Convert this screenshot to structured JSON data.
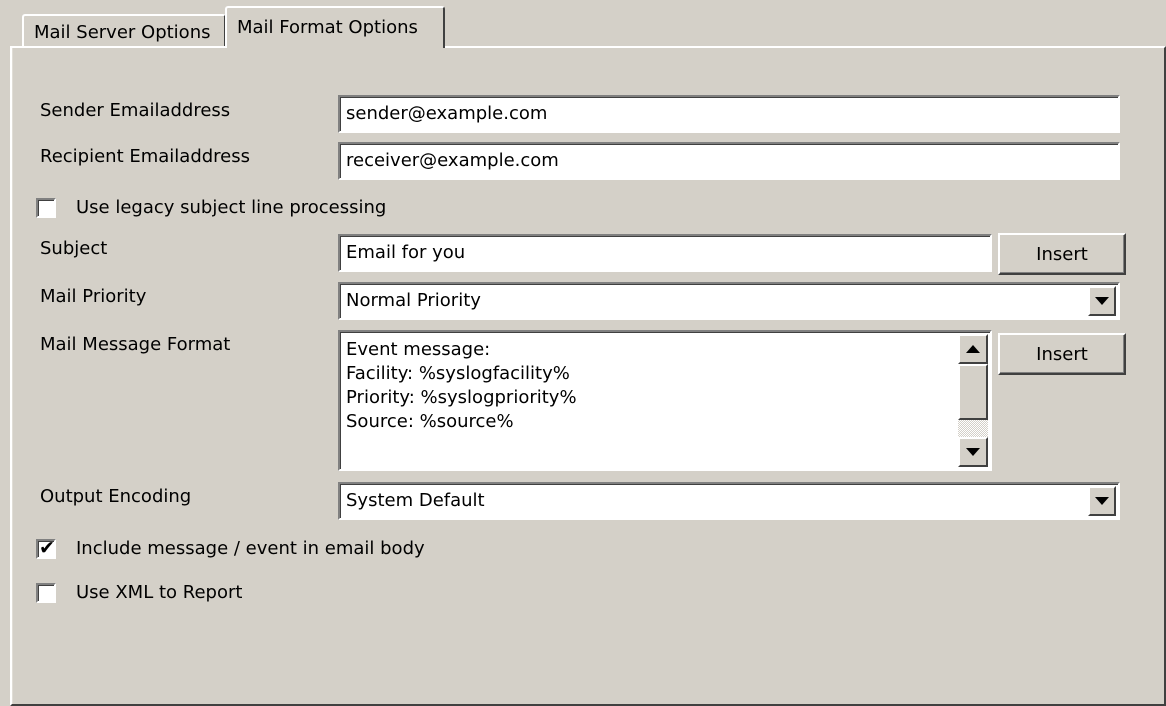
{
  "tabs": [
    {
      "label": "Mail Server Options",
      "active": false
    },
    {
      "label": "Mail Format Options",
      "active": true
    }
  ],
  "form": {
    "sender": {
      "label": "Sender Emailaddress",
      "value": "sender@example.com"
    },
    "recipient": {
      "label": "Recipient Emailaddress",
      "value": "receiver@example.com"
    },
    "legacy_subject": {
      "label": "Use legacy subject line processing",
      "checked": false
    },
    "subject": {
      "label": "Subject",
      "value": "Email for you",
      "insert_label": "Insert"
    },
    "priority": {
      "label": "Mail Priority",
      "value": "Normal Priority"
    },
    "message_format": {
      "label": "Mail Message Format",
      "lines": [
        "Event message:",
        "Facility: %syslogfacility%",
        "Priority: %syslogpriority%",
        "Source: %source%"
      ],
      "insert_label": "Insert"
    },
    "encoding": {
      "label": "Output Encoding",
      "value": "System Default"
    },
    "include_message": {
      "label": "Include message / event in email body",
      "checked": true
    },
    "use_xml": {
      "label": "Use XML to Report",
      "checked": false
    }
  },
  "icons": {
    "checkmark": "✔"
  },
  "colors": {
    "background": "#d4d0c8",
    "field": "#ffffff"
  }
}
